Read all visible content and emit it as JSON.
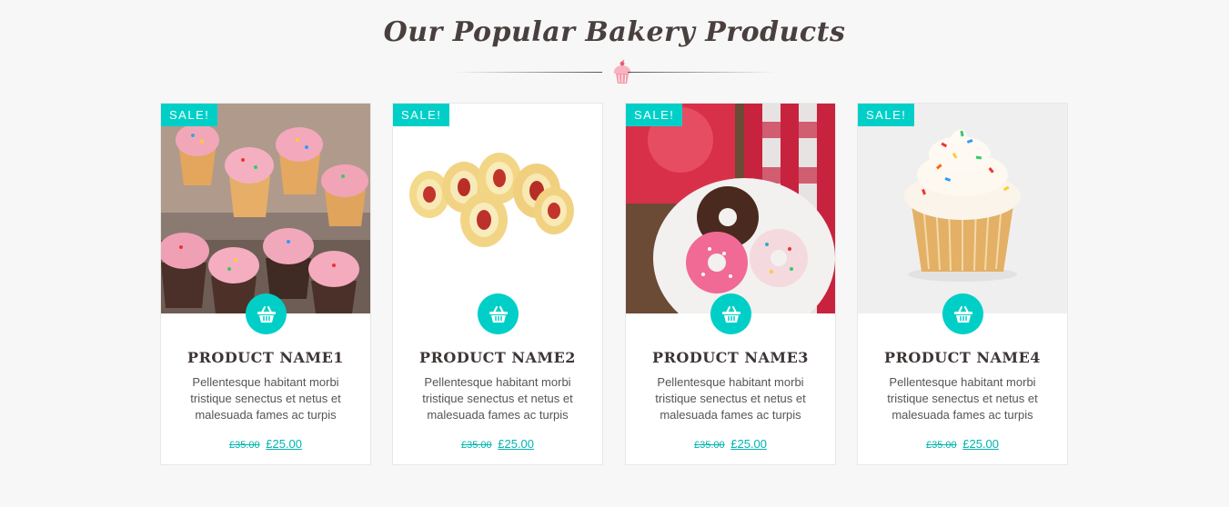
{
  "section": {
    "title": "Our Popular Bakery Products",
    "accent_color": "#00cfc8"
  },
  "products": [
    {
      "badge": "SALE!",
      "name": "PRODUCT NAME1",
      "description": "Pellentesque habitant morbi tristique senectus et netus et malesuada fames ac turpis",
      "old_price": "£35.00",
      "price": "£25.00",
      "image": "pink-cupcakes-image",
      "cart_icon": "basket-icon"
    },
    {
      "badge": "SALE!",
      "name": "PRODUCT NAME2",
      "description": "Pellentesque habitant morbi tristique senectus et netus et malesuada fames ac turpis",
      "old_price": "£35.00",
      "price": "£25.00",
      "image": "swiss-roll-image",
      "cart_icon": "basket-icon"
    },
    {
      "badge": "SALE!",
      "name": "PRODUCT NAME3",
      "description": "Pellentesque habitant morbi tristique senectus et netus et malesuada fames ac turpis",
      "old_price": "£35.00",
      "price": "£25.00",
      "image": "donuts-image",
      "cart_icon": "basket-icon"
    },
    {
      "badge": "SALE!",
      "name": "PRODUCT NAME4",
      "description": "Pellentesque habitant morbi tristique senectus et netus et malesuada fames ac turpis",
      "old_price": "£35.00",
      "price": "£25.00",
      "image": "vanilla-cupcake-image",
      "cart_icon": "basket-icon"
    }
  ]
}
